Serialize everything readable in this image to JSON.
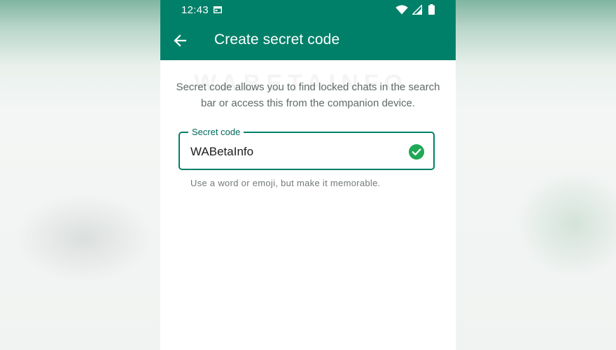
{
  "status_bar": {
    "time": "12:43",
    "calendar_icon": "calendar-icon",
    "wifi_icon": "wifi-icon",
    "signal_icon": "signal-icon",
    "battery_icon": "battery-icon"
  },
  "app_bar": {
    "back_icon": "arrow-back-icon",
    "title": "Create secret code",
    "color": "#008069"
  },
  "watermark": "WABETAINFO",
  "description": "Secret code allows you to find locked chats in the search bar or access this from the companion device.",
  "secret_code_field": {
    "label": "Secret code",
    "value": "WABetaInfo",
    "valid_icon": "check-circle-icon",
    "accent_color": "#008069"
  },
  "helper_text": "Use a word or emoji, but make it memorable."
}
